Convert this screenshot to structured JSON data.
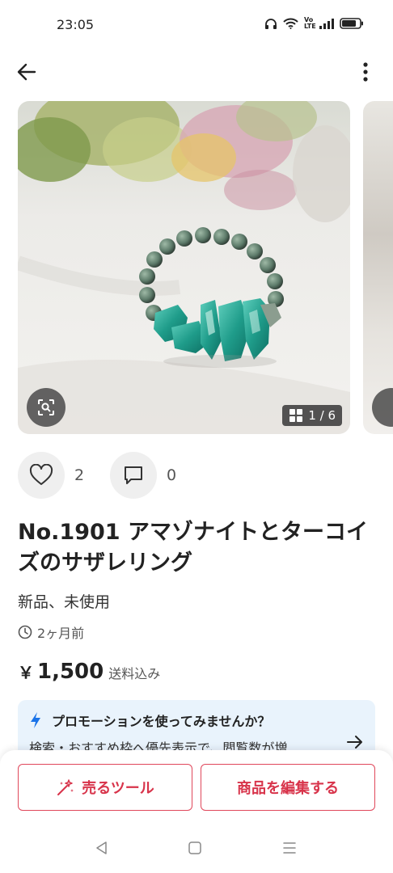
{
  "status_bar": {
    "time": "23:05",
    "icons": [
      "headphones-icon",
      "wifi-icon",
      "volte-icon",
      "signal-icon",
      "battery-icon"
    ],
    "volte_label": "Vo LTE"
  },
  "header": {
    "back_icon": "arrow-left-icon",
    "more_icon": "more-vertical-icon"
  },
  "gallery": {
    "counter": "1 / 6",
    "lens_icon": "image-search-icon",
    "grid_icon": "grid-icon"
  },
  "reactions": {
    "likes": "2",
    "comments": "0"
  },
  "item": {
    "title": "No.1901 アマゾナイトとターコイズのサザレリング",
    "condition": "新品、未使用",
    "posted": "2ヶ月前",
    "price_symbol": "￥",
    "price": "1,500",
    "shipping": "送料込み"
  },
  "promo": {
    "title": "プロモーションを使ってみませんか？",
    "body": "検索・おすすめ枠へ優先表示で、閲覧数が増"
  },
  "actions": {
    "tools_label": "売るツール",
    "edit_label": "商品を編集する"
  },
  "colors": {
    "accent_red": "#d8344b",
    "promo_bg": "#e9f3fc",
    "bolt_blue": "#1a73e8"
  }
}
